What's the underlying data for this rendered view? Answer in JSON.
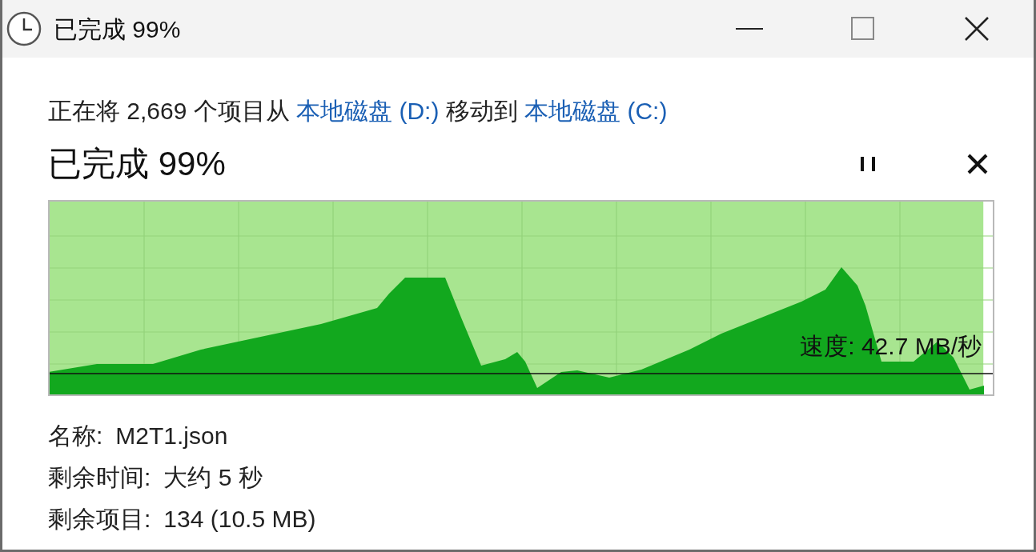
{
  "window": {
    "title": "已完成 99%"
  },
  "description": {
    "prefix": "正在将 2,669 个项目从",
    "source": "本地磁盘 (D:)",
    "middle": "移动到",
    "destination": "本地磁盘 (C:)"
  },
  "heading": "已完成 99%",
  "progress": {
    "level": 0.99,
    "speed_label": "速度: 42.7 MB/秒"
  },
  "details": [
    {
      "label": "名称:",
      "value": "M2T1.json"
    },
    {
      "label": "剩余时间:",
      "value": "大约 5 秒"
    },
    {
      "label": "剩余项目:",
      "value": "134 (10.5 MB)"
    }
  ]
}
